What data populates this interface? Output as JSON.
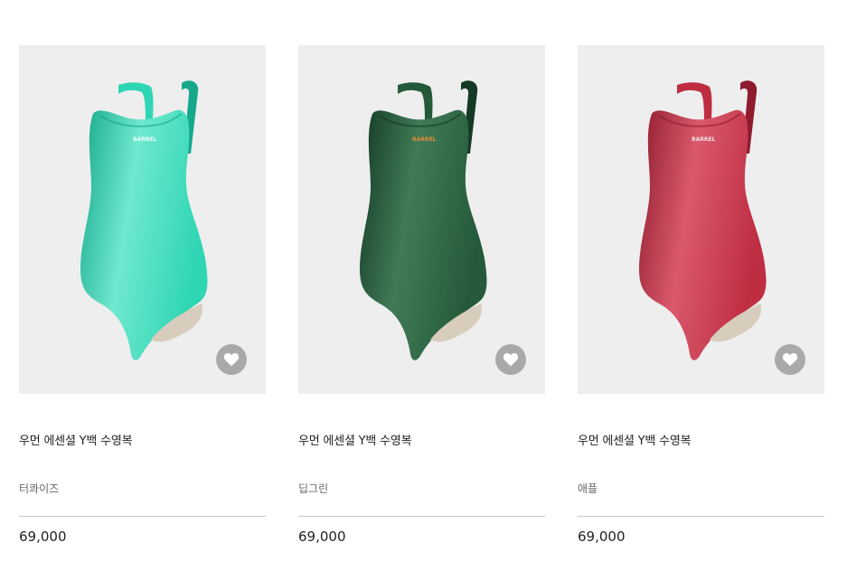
{
  "products": [
    {
      "name": "우먼 에센셜 Y백 수영복",
      "color_name": "터콰이즈",
      "price": "69,000",
      "swatch": "#2fd6b3",
      "swatch_dark": "#16a88a",
      "swatch_light": "#6fe8cf",
      "logo": "BARREL",
      "logo_color": "#e9fff9"
    },
    {
      "name": "우먼 에센셜 Y백 수영복",
      "color_name": "딥그린",
      "price": "69,000",
      "swatch": "#245a3a",
      "swatch_dark": "#143a25",
      "swatch_light": "#3f7a55",
      "logo": "BARREL",
      "logo_color": "#e08a3c"
    },
    {
      "name": "우먼 에센셜 Y백 수영복",
      "color_name": "애플",
      "price": "69,000",
      "swatch": "#bf2d43",
      "swatch_dark": "#8e1c2e",
      "swatch_light": "#d9596b",
      "logo": "BARREL",
      "logo_color": "#f2dfe2"
    }
  ],
  "icons": {
    "wishlist": "heart-icon",
    "product_image": "swimsuit-image"
  }
}
